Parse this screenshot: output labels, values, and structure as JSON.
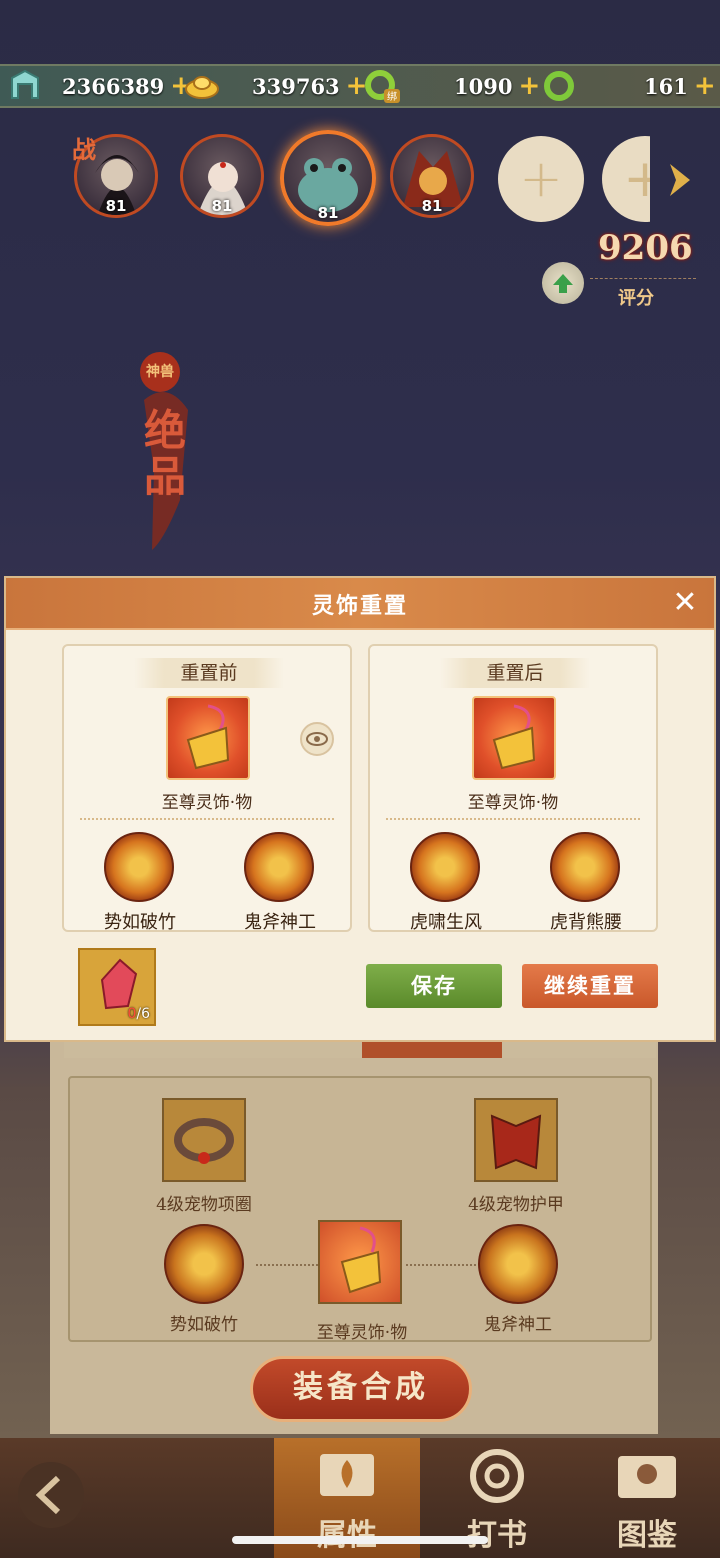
{
  "currencies": [
    {
      "icon": "jade-gate-icon",
      "value": "2366389"
    },
    {
      "icon": "gold-ingot-icon",
      "value": "339763"
    },
    {
      "icon": "bound-jade-dragon-icon",
      "value": "1090",
      "badge": "绑"
    },
    {
      "icon": "jade-dragon-icon",
      "value": "161"
    }
  ],
  "team": {
    "battle_tag": "战",
    "heroes": [
      {
        "name": "hero-1",
        "level": "81"
      },
      {
        "name": "hero-2",
        "level": "81"
      },
      {
        "name": "hero-frog",
        "level": "81"
      },
      {
        "name": "hero-4",
        "level": "81"
      }
    ],
    "add_symbol": "+"
  },
  "score": {
    "value": "9206",
    "label": "评分"
  },
  "quality": {
    "tag": "神兽",
    "text": "绝品"
  },
  "modal": {
    "title": "灵饰重置",
    "close": "✕",
    "before": {
      "title": "重置前",
      "item_name": "至尊灵饰·物",
      "skills": [
        "势如破竹",
        "鬼斧神工"
      ]
    },
    "after": {
      "title": "重置后",
      "item_name": "至尊灵饰·物",
      "skills": [
        "虎啸生风",
        "虎背熊腰"
      ]
    },
    "material": {
      "count": "0",
      "total": "/6"
    },
    "save_label": "保存",
    "continue_label": "继续重置"
  },
  "equipment": {
    "collar": "4级宠物项圈",
    "armor": "4级宠物护甲",
    "skill_left": "势如破竹",
    "center_item": "至尊灵饰·物",
    "skill_right": "鬼斧神工",
    "compose_label": "装备合成"
  },
  "nav": {
    "attributes": "属性",
    "book": "打书",
    "codex": "图鉴"
  },
  "colors": {
    "accent": "#d98a4a",
    "save": "#6c9a3a",
    "continue": "#d96a3a"
  }
}
